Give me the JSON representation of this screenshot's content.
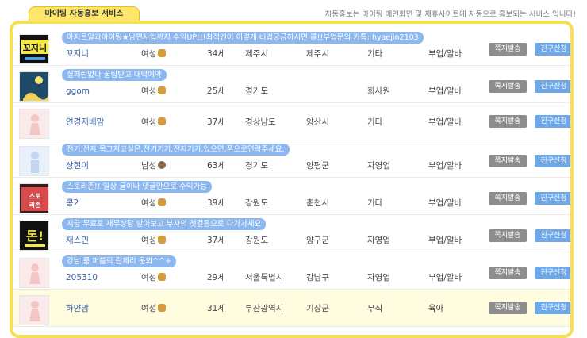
{
  "tab_label": "마이팅 자동홍보 서비스",
  "notice": "자동홍보는 마이팅 메인화면 및 제휴사이트에 자동으로 홍보되는 서비스 입니다!",
  "buttons": {
    "message": "쪽지발송",
    "friend": "친구신청"
  },
  "rows": [
    {
      "promo": "아지트알과마이팅★남편사업까지 수익UP!!!최적엔이 이렇게 비법궁금하시면 콜!!부업문의 카톡: hyaejin2103",
      "nick": "꼬지니",
      "gender": "여성",
      "age": "34세",
      "region1": "제주시",
      "region2": "제주시",
      "job": "기타",
      "position": "부업/알바",
      "avatar_text": "꼬지니",
      "avatar_kind": "logo",
      "gender_icon": "female"
    },
    {
      "promo": "실패란없다 꿀팁받고 대박예약",
      "nick": "ggom",
      "gender": "여성",
      "age": "25세",
      "region1": "경기도",
      "region2": "",
      "job": "회사원",
      "position": "부업/알바",
      "avatar_text": "",
      "avatar_kind": "night",
      "gender_icon": "female"
    },
    {
      "promo": "",
      "nick": "연경지배맘",
      "gender": "여성",
      "age": "37세",
      "region1": "경상남도",
      "region2": "양산시",
      "job": "기타",
      "position": "부업/알바",
      "avatar_text": "",
      "avatar_kind": "female",
      "gender_icon": "female"
    },
    {
      "promo": "전기,전자,목고치고실은,전기기기,전자기기,있으면,폰으로연락주세요.",
      "nick": "상현이",
      "gender": "남성",
      "age": "63세",
      "region1": "경기도",
      "region2": "양평군",
      "job": "자영업",
      "position": "부업/알바",
      "avatar_text": "",
      "avatar_kind": "male",
      "gender_icon": "male"
    },
    {
      "promo": "스토리존!! 일상 글이나 댓글만으로 수익가능",
      "nick": "콩2",
      "gender": "여성",
      "age": "39세",
      "region1": "강원도",
      "region2": "춘천시",
      "job": "기타",
      "position": "부업/알바",
      "avatar_text": "스토리존",
      "avatar_kind": "story",
      "gender_icon": "female"
    },
    {
      "promo": "지금 무료로 재무상담 받아보고 부자의 첫걸음으로 다가가세요",
      "nick": "재스민",
      "gender": "여성",
      "age": "37세",
      "region1": "강원도",
      "region2": "양구군",
      "job": "자영업",
      "position": "부업/알바",
      "avatar_text": "돈!",
      "avatar_kind": "money",
      "gender_icon": "female"
    },
    {
      "promo": "강남 룸 퍼블릭 란제리 문의^^+",
      "nick": "205310",
      "gender": "여성",
      "age": "29세",
      "region1": "서울특별시",
      "region2": "강남구",
      "job": "자영업",
      "position": "부업/알바",
      "avatar_text": "",
      "avatar_kind": "female",
      "gender_icon": "female"
    },
    {
      "promo": "",
      "nick": "하얀맘",
      "gender": "여성",
      "age": "31세",
      "region1": "부산광역시",
      "region2": "기장군",
      "job": "무직",
      "position": "육아",
      "avatar_text": "",
      "avatar_kind": "female",
      "gender_icon": "female"
    }
  ]
}
